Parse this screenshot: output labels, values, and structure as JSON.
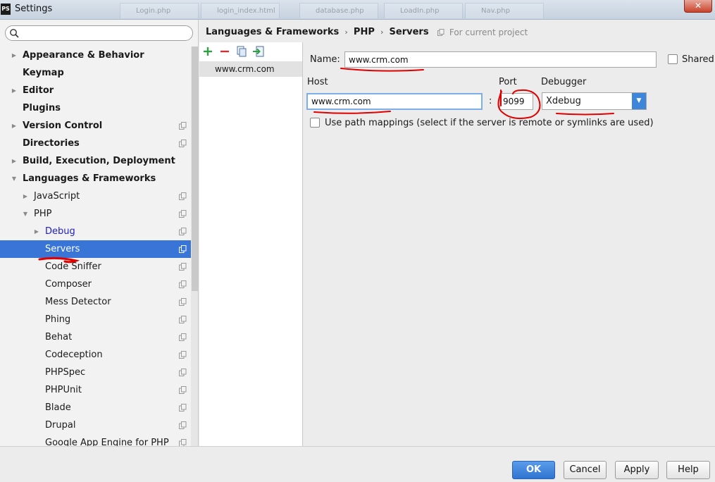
{
  "window": {
    "title": "Settings",
    "app_logo": "PS",
    "close_glyph": "✕"
  },
  "background_tabs": [
    "Login.php",
    "login_index.html",
    "database.php",
    "LoadIn.php",
    "Nav.php"
  ],
  "search": {
    "placeholder": "",
    "value": ""
  },
  "sidebar": {
    "items": [
      {
        "label": "Appearance & Behavior",
        "bold": true,
        "arrow": "right",
        "level": 0,
        "project_icon": false
      },
      {
        "label": "Keymap",
        "bold": true,
        "arrow": "none",
        "level": 0,
        "project_icon": false
      },
      {
        "label": "Editor",
        "bold": true,
        "arrow": "right",
        "level": 0,
        "project_icon": false
      },
      {
        "label": "Plugins",
        "bold": true,
        "arrow": "none",
        "level": 0,
        "project_icon": false
      },
      {
        "label": "Version Control",
        "bold": true,
        "arrow": "right",
        "level": 0,
        "project_icon": true
      },
      {
        "label": "Directories",
        "bold": true,
        "arrow": "none",
        "level": 0,
        "project_icon": true
      },
      {
        "label": "Build, Execution, Deployment",
        "bold": true,
        "arrow": "right",
        "level": 0,
        "project_icon": false
      },
      {
        "label": "Languages & Frameworks",
        "bold": true,
        "arrow": "down",
        "level": 0,
        "project_icon": false
      },
      {
        "label": "JavaScript",
        "bold": false,
        "arrow": "right",
        "level": 1,
        "project_icon": true
      },
      {
        "label": "PHP",
        "bold": false,
        "arrow": "down",
        "level": 1,
        "project_icon": true
      },
      {
        "label": "Debug",
        "bold": false,
        "arrow": "right",
        "level": 2,
        "project_icon": true,
        "link": true
      },
      {
        "label": "Servers",
        "bold": false,
        "arrow": "none",
        "level": 2,
        "project_icon": true,
        "selected": true
      },
      {
        "label": "Code Sniffer",
        "bold": false,
        "arrow": "none",
        "level": 2,
        "project_icon": true
      },
      {
        "label": "Composer",
        "bold": false,
        "arrow": "none",
        "level": 2,
        "project_icon": true
      },
      {
        "label": "Mess Detector",
        "bold": false,
        "arrow": "none",
        "level": 2,
        "project_icon": true
      },
      {
        "label": "Phing",
        "bold": false,
        "arrow": "none",
        "level": 2,
        "project_icon": true
      },
      {
        "label": "Behat",
        "bold": false,
        "arrow": "none",
        "level": 2,
        "project_icon": true
      },
      {
        "label": "Codeception",
        "bold": false,
        "arrow": "none",
        "level": 2,
        "project_icon": true
      },
      {
        "label": "PHPSpec",
        "bold": false,
        "arrow": "none",
        "level": 2,
        "project_icon": true
      },
      {
        "label": "PHPUnit",
        "bold": false,
        "arrow": "none",
        "level": 2,
        "project_icon": true
      },
      {
        "label": "Blade",
        "bold": false,
        "arrow": "none",
        "level": 2,
        "project_icon": true
      },
      {
        "label": "Drupal",
        "bold": false,
        "arrow": "none",
        "level": 2,
        "project_icon": true
      },
      {
        "label": "Google App Engine for PHP",
        "bold": false,
        "arrow": "none",
        "level": 2,
        "project_icon": true
      }
    ]
  },
  "breadcrumb": {
    "items": [
      "Languages & Frameworks",
      "PHP",
      "Servers"
    ],
    "separator": "›",
    "scope": "For current project"
  },
  "servers": {
    "items": [
      "www.crm.com"
    ]
  },
  "form": {
    "name_label": "Name:",
    "name_value": "www.crm.com",
    "shared_label": "Shared",
    "host_label": "Host",
    "host_value": "www.crm.com",
    "colon": ":",
    "port_label": "Port",
    "port_value": "9099",
    "debugger_label": "Debugger",
    "debugger_value": "Xdebug",
    "path_mappings_label": "Use path mappings (select if the server is remote or symlinks are used)"
  },
  "buttons": {
    "ok": "OK",
    "cancel": "Cancel",
    "apply": "Apply",
    "help": "Help"
  },
  "colors": {
    "selection": "#3875d7",
    "primary_button": "#3d86da",
    "annotation": "#e00000"
  }
}
